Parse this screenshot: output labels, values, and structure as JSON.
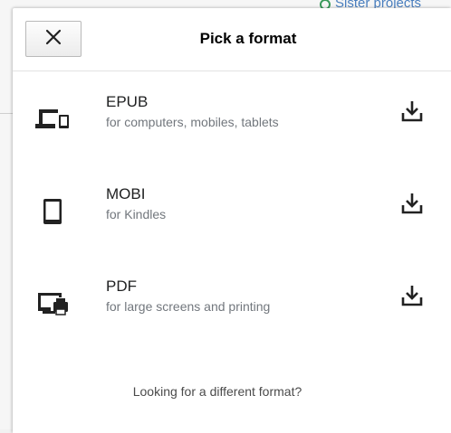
{
  "background": {
    "link_text": "Sister projects",
    "link_icon": "wikimedia-logo-icon"
  },
  "dialog": {
    "title": "Pick a format",
    "close_icon": "close-icon",
    "formats": [
      {
        "name": "EPUB",
        "description": "for computers, mobiles, tablets",
        "icon": "devices-icon"
      },
      {
        "name": "MOBI",
        "description": "for Kindles",
        "icon": "tablet-icon"
      },
      {
        "name": "PDF",
        "description": "for large screens and printing",
        "icon": "print-screen-icon"
      }
    ],
    "download_icon": "download-icon",
    "footer_link": "Looking for a different format?"
  },
  "colors": {
    "text": "#202122",
    "secondary_text": "#72777d",
    "link": "#4a7fbf"
  }
}
